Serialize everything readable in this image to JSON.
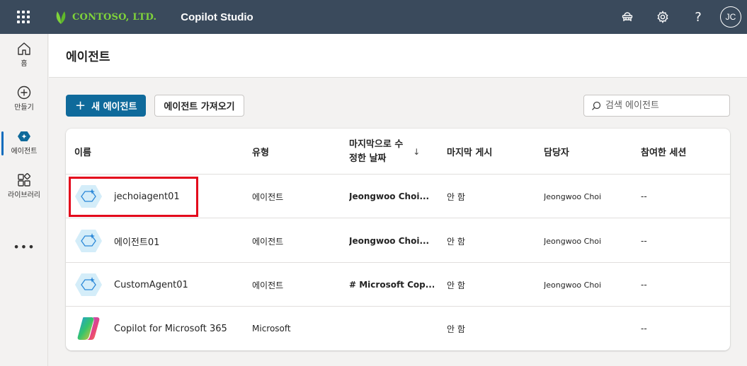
{
  "topbar": {
    "brand_name": "CONTOSO, LTD.",
    "app_title": "Copilot Studio",
    "avatar_initials": "JC",
    "icons": [
      "waffle-icon",
      "environment-icon",
      "settings-icon",
      "help-icon"
    ],
    "help_glyph": "?"
  },
  "rail": {
    "items": [
      {
        "label": "홈",
        "icon": "home-icon"
      },
      {
        "label": "만들기",
        "icon": "create-icon"
      },
      {
        "label": "에이전트",
        "icon": "agents-icon",
        "active": true
      },
      {
        "label": "라이브러리",
        "icon": "library-icon"
      }
    ],
    "more": "•••"
  },
  "page": {
    "title": "에이전트",
    "new_agent_button": "새 에이전트",
    "import_agent_button": "에이전트 가져오기",
    "search_placeholder": "검색 에이전트"
  },
  "table": {
    "columns": {
      "name": "이름",
      "type": "유형",
      "modified_line1": "마지막으로 수",
      "modified_line2": "정한 날짜",
      "modified_sort": "↓",
      "published": "마지막 게시",
      "owner": "담당자",
      "sessions": "참여한 세션"
    },
    "rows": [
      {
        "name": "jechoiagent01",
        "type": "에이전트",
        "modified_by": "Jeongwoo Choi...",
        "published": "안 함",
        "owner": "Jeongwoo Choi",
        "sessions": "--",
        "icon": "agent-icon",
        "highlighted": true
      },
      {
        "name": "에이전트01",
        "type": "에이전트",
        "modified_by": "Jeongwoo Choi...",
        "published": "안 함",
        "owner": "Jeongwoo Choi",
        "sessions": "--",
        "icon": "agent-icon"
      },
      {
        "name": "CustomAgent01",
        "type": "에이전트",
        "modified_by": "# Microsoft Cop...",
        "published": "안 함",
        "owner": "Jeongwoo Choi",
        "sessions": "--",
        "icon": "agent-icon"
      },
      {
        "name": "Copilot for Microsoft 365",
        "type": "Microsoft",
        "modified_by": "",
        "published": "안 함",
        "owner": "",
        "sessions": "--",
        "icon": "copilot-logo-icon"
      }
    ]
  },
  "colors": {
    "topbar": "#3a4a5c",
    "brand": "#7fd33a",
    "primary_button": "#0f6a9b",
    "highlight_border": "#e3051b"
  }
}
